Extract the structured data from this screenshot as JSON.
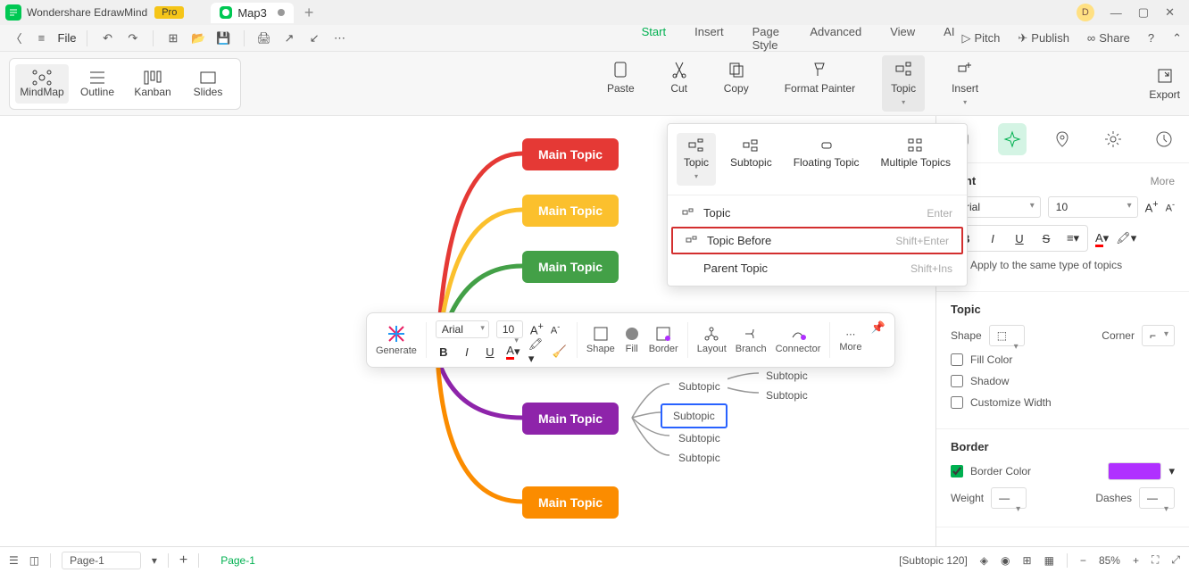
{
  "app": {
    "name": "Wondershare EdrawMind",
    "badge": "Pro",
    "doc_name": "Map3",
    "avatar_letter": "D"
  },
  "file_label": "File",
  "menu_tabs": [
    "Start",
    "Insert",
    "Page Style",
    "Advanced",
    "View",
    "AI"
  ],
  "right_actions": {
    "pitch": "Pitch",
    "publish": "Publish",
    "share": "Share"
  },
  "view_modes": [
    "MindMap",
    "Outline",
    "Kanban",
    "Slides"
  ],
  "ribbon": {
    "paste": "Paste",
    "cut": "Cut",
    "copy": "Copy",
    "format_painter": "Format Painter",
    "topic": "Topic",
    "insert": "Insert",
    "export": "Export"
  },
  "topic_dd": {
    "row1": [
      "Topic",
      "Subtopic",
      "Floating Topic",
      "Multiple Topics"
    ],
    "items": [
      {
        "label": "Topic",
        "shortcut": "Enter"
      },
      {
        "label": "Topic Before",
        "shortcut": "Shift+Enter"
      },
      {
        "label": "Parent Topic",
        "shortcut": "Shift+Ins"
      }
    ]
  },
  "canvas": {
    "main_topics": [
      "Main Topic",
      "Main Topic",
      "Main Topic",
      "Main Topic",
      "Main Topic"
    ],
    "subtopics": [
      "Subtopic",
      "Subtopic",
      "Subtopic",
      "Subtopic",
      "Subtopic",
      "Subtopic"
    ]
  },
  "float_tb": {
    "generate": "Generate",
    "font": "Arial",
    "size": "10",
    "shape": "Shape",
    "fill": "Fill",
    "border": "Border",
    "layout": "Layout",
    "branch": "Branch",
    "connector": "Connector",
    "more": "More"
  },
  "panel": {
    "font": {
      "title": "Font",
      "more": "More",
      "family": "Arial",
      "size": "10",
      "apply_same": "Apply to the same type of topics"
    },
    "topic": {
      "title": "Topic",
      "shape": "Shape",
      "corner": "Corner",
      "fill": "Fill Color",
      "shadow": "Shadow",
      "custom_width": "Customize Width"
    },
    "border": {
      "title": "Border",
      "color_label": "Border Color",
      "weight": "Weight",
      "dashes": "Dashes",
      "color": "#b030ff"
    }
  },
  "status": {
    "page_sel": "Page-1",
    "page_tab": "Page-1",
    "selection": "[Subtopic 120]",
    "zoom": "85%"
  }
}
